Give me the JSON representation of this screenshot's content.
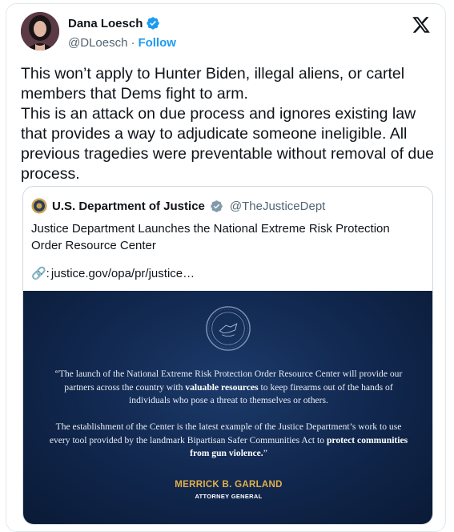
{
  "author": {
    "name": "Dana Loesch",
    "handle": "@DLoesch",
    "separator": "·",
    "follow_label": "Follow"
  },
  "tweet": {
    "line1": "This won’t apply to Hunter Biden, illegal aliens, or cartel members that Dems fight to arm.",
    "line2": "This is an attack on due process and ignores existing law that provides a way to adjudicate someone ineligible. All previous tragedies were preventable without removal of due process."
  },
  "quote": {
    "name": "U.S. Department of Justice",
    "handle": "@TheJusticeDept",
    "text": "Justice Department Launches the National Extreme Risk Protection Order Resource Center",
    "link_prefix": "🔗: ",
    "link": "justice.gov/opa/pr/justice…",
    "image": {
      "para1_a": "“The launch of the National Extreme Risk Protection Order Resource Center will provide our partners across the country with ",
      "para1_bold": "valuable resources",
      "para1_b": " to keep firearms out of the hands of individuals who pose a threat to themselves or others.",
      "para2_a": "The establishment of the Center is the latest example of the Justice Department’s work to use every tool provided by the landmark Bipartisan Safer Communities Act to ",
      "para2_bold": "protect communities from gun violence.",
      "para2_b": "”",
      "speaker": "MERRICK B. GARLAND",
      "speaker_title": "ATTORNEY GENERAL"
    }
  },
  "colors": {
    "verified_blue": "#1d9bf0",
    "verified_gray": "#829aab",
    "image_bg": "#10264c",
    "speaker_gold": "#e3b04b"
  },
  "icons": [
    "verified-badge-icon",
    "x-logo-icon",
    "link-icon",
    "doj-seal-icon",
    "gray-verified-badge-icon"
  ]
}
